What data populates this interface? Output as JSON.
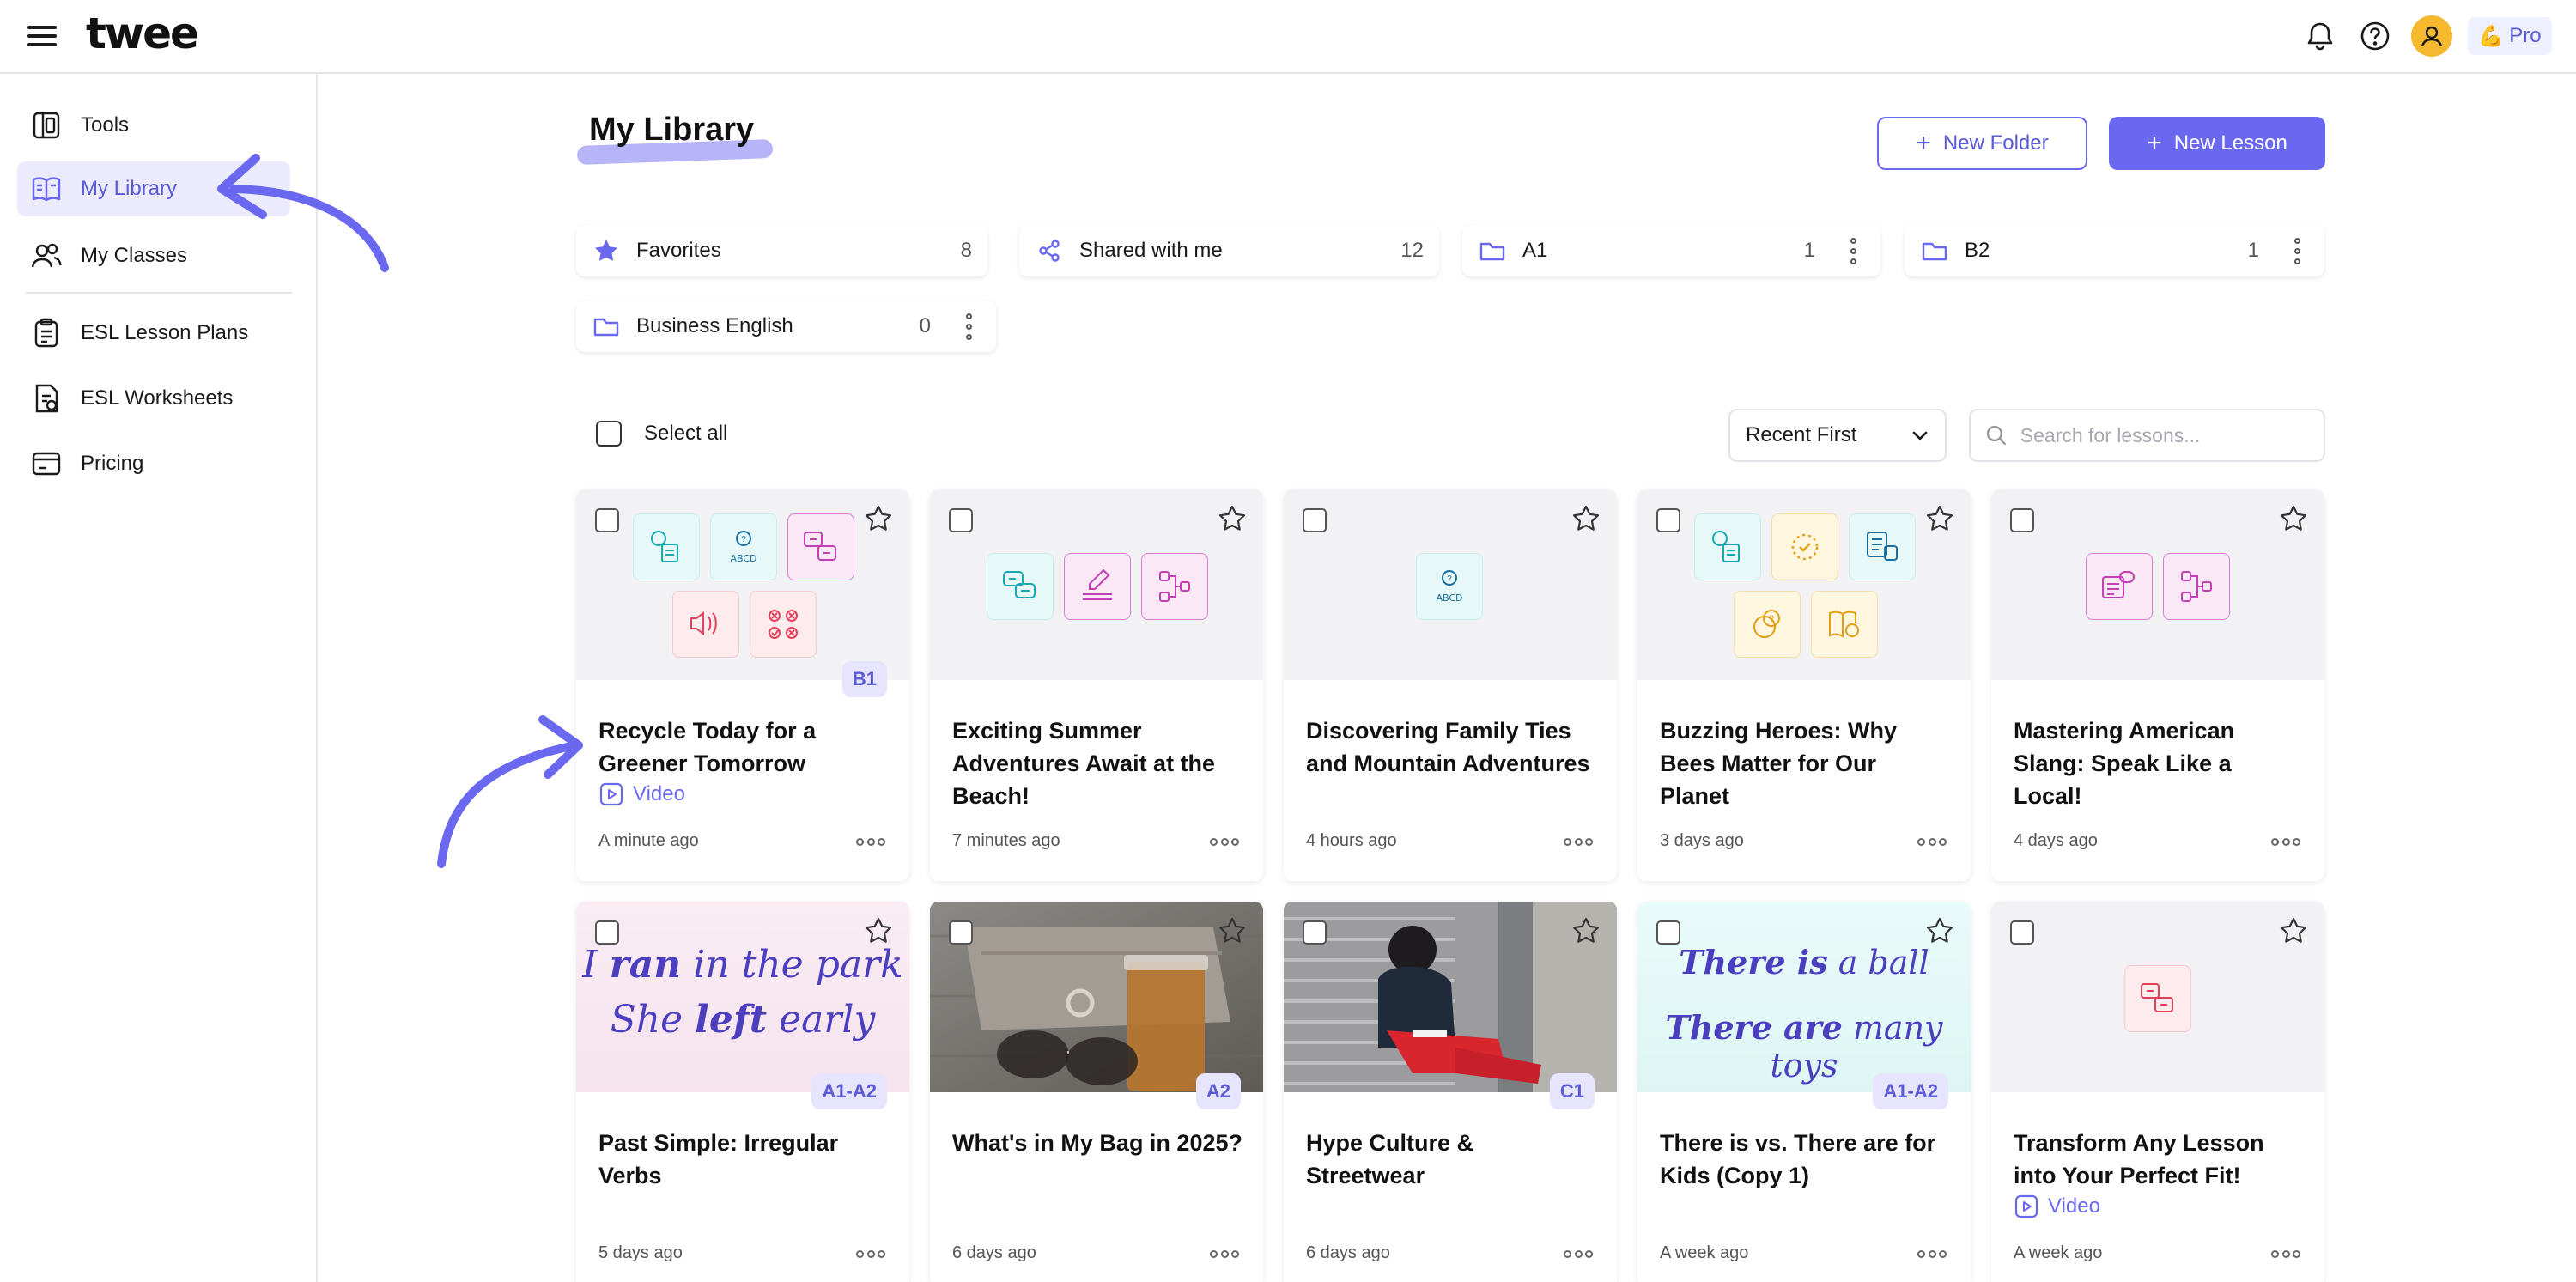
{
  "app": {
    "logo": "twee",
    "pro_label": "Pro",
    "pro_emoji": "💪"
  },
  "sidebar": {
    "items": [
      {
        "label": "Tools",
        "icon": "tools-icon"
      },
      {
        "label": "My Library",
        "icon": "library-book-icon",
        "active": true
      },
      {
        "label": "My Classes",
        "icon": "users-icon"
      },
      {
        "label": "ESL Lesson Plans",
        "icon": "clipboard-icon"
      },
      {
        "label": "ESL Worksheets",
        "icon": "worksheet-icon"
      },
      {
        "label": "Pricing",
        "icon": "pricing-card-icon"
      }
    ]
  },
  "main": {
    "title": "My Library",
    "new_folder_label": "New Folder",
    "new_lesson_label": "New Lesson",
    "folders": [
      {
        "name": "Favorites",
        "count": "8"
      },
      {
        "name": "Shared with me",
        "count": "12"
      },
      {
        "name": "A1",
        "count": "1"
      },
      {
        "name": "B2",
        "count": "1"
      },
      {
        "name": "Business English",
        "count": "0"
      }
    ],
    "select_all_label": "Select all",
    "sort_value": "Recent First",
    "search_placeholder": "Search for lessons..."
  },
  "lessons": [
    {
      "title": "Recycle Today for a Greener Tomorrow",
      "level": "B1",
      "tag": "Video",
      "time": "A minute ago"
    },
    {
      "title": "Exciting Summer Adventures Await at the Beach!",
      "time": "7 minutes ago"
    },
    {
      "title": "Discovering Family Ties and Mountain Adventures",
      "time": "4 hours ago"
    },
    {
      "title": "Buzzing Heroes: Why Bees Matter for Our Planet",
      "time": "3 days ago"
    },
    {
      "title": "Mastering American Slang: Speak Like a Local!",
      "time": "4 days ago"
    },
    {
      "title": "Past Simple: Irregular Verbs",
      "level": "A1-A2",
      "time": "5 days ago",
      "thumb_line1_a": "I ",
      "thumb_line1_b": "ran",
      "thumb_line1_c": " in the park",
      "thumb_line2_a": "She ",
      "thumb_line2_b": "left",
      "thumb_line2_c": " early"
    },
    {
      "title": "What's in My Bag in 2025?",
      "level": "A2",
      "time": "6 days ago"
    },
    {
      "title": "Hype Culture & Streetwear",
      "level": "C1",
      "time": "6 days ago"
    },
    {
      "title": "There is vs. There are for Kids (Copy 1)",
      "level": "A1-A2",
      "time": "A week ago",
      "thumb_line1_a": "There is",
      "thumb_line1_b": " a ball",
      "thumb_line2_a": "There are",
      "thumb_line2_b": " many toys"
    },
    {
      "title": "Transform Any Lesson into Your Perfect Fit!",
      "tag": "Video",
      "time": "A week ago"
    }
  ],
  "colors": {
    "accent": "#6b68f0",
    "accent_light": "#ebebfd",
    "badge_bg": "#e7e5fd"
  }
}
